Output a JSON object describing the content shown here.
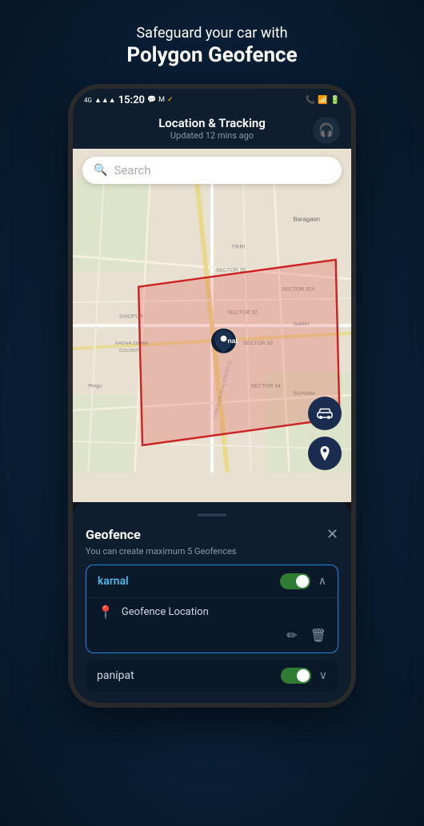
{
  "page": {
    "headline_sub": "Safeguard your car with",
    "headline_main": "Polygon Geofence"
  },
  "status_bar": {
    "time": "15:20",
    "left_icons": "4G  ⊿⊿",
    "right_icons": "🔔 📶 🔋"
  },
  "app_header": {
    "title": "Location & Tracking",
    "subtitle": "Updated 12 mins ago",
    "headset_icon": "🎧"
  },
  "search": {
    "placeholder": "Search",
    "icon": "🔍"
  },
  "map": {
    "location_labels": [
      "Baragaon",
      "TIKRI",
      "SECTOR 30",
      "SECTOR 32A",
      "SAIDPUR",
      "SECTOR 32",
      "Subhri",
      "RADHA SWAMI COLONY",
      "SECTOR 33",
      "Pingu",
      "SECTOR 34",
      "SUHANA"
    ],
    "fab_car_icon": "🚗",
    "fab_pin_icon": "📍"
  },
  "geofence_panel": {
    "title": "Geofence",
    "close_icon": "✕",
    "subtitle": "You can create maximum 5 Geofences",
    "items": [
      {
        "name": "karnal",
        "toggle_on": true,
        "expanded": true,
        "location_label": "Geofence Location",
        "edit_icon": "✏",
        "delete_icon": "🗑"
      },
      {
        "name": "panipat",
        "toggle_on": true,
        "expanded": false
      }
    ]
  },
  "colors": {
    "accent_blue": "#1e88e5",
    "toggle_green": "#2e7d32",
    "geofence_fill": "rgba(220,50,50,0.25)",
    "geofence_stroke": "#cc2222"
  }
}
